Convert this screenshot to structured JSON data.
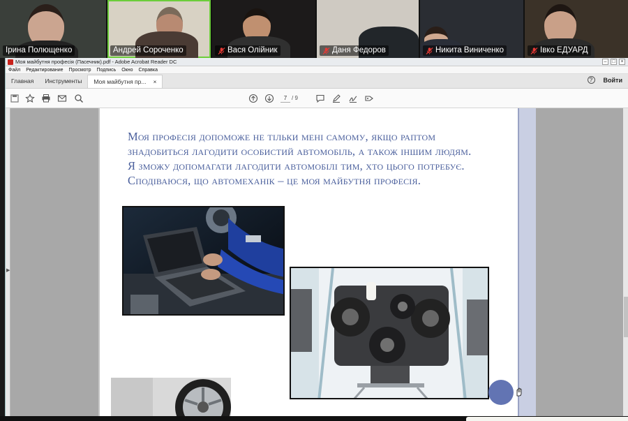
{
  "participants": [
    {
      "name": "Ірина Полющенко",
      "muted": false,
      "active": false,
      "bg": "#3a3f3a",
      "skin": "#cba590",
      "hair": "#2a1f1a",
      "shirt": "#222222"
    },
    {
      "name": "Андрей Сороченко",
      "muted": false,
      "active": true,
      "bg": "#d8d2c4",
      "skin": "#b88a72",
      "hair": "#7a6a5a",
      "shirt": "#4a3b34"
    },
    {
      "name": "Вася Олійник",
      "muted": true,
      "active": false,
      "bg": "#1c1a1a",
      "skin": "#c09070",
      "hair": "#1a1410",
      "shirt": "#303030"
    },
    {
      "name": "Даня Федоров",
      "muted": true,
      "active": false,
      "bg": "#cfcac2",
      "skin": "#b88f78",
      "hair": "#3d2e24",
      "shirt": "#22262a"
    },
    {
      "name": "Никита Виниченко",
      "muted": true,
      "active": false,
      "bg": "#2a2d33",
      "skin": "#d0a990",
      "hair": "#2a1e18",
      "shirt": "#2a2e38"
    },
    {
      "name": "Івко ЕДУАРД",
      "muted": true,
      "active": false,
      "bg": "#3b3228",
      "skin": "#c9a088",
      "hair": "#1e1612",
      "shirt": "#2b2b2b"
    }
  ],
  "window": {
    "title": "Моя майбутня професія (Пасечник).pdf - Adobe Acrobat Reader DC",
    "controls": [
      "–",
      "□",
      "×"
    ]
  },
  "menu": [
    "Файл",
    "Редактирование",
    "Просмотр",
    "Подпись",
    "Окно",
    "Справка"
  ],
  "tabs": {
    "home": "Главная",
    "tools": "Инструменты",
    "document": "Моя майбутня пр...",
    "close": "×",
    "help": "?",
    "signin": "Войти"
  },
  "toolbar": {
    "current_page": "7",
    "total_pages": "/ 9"
  },
  "document": {
    "paragraph": "Моя професія допоможе не тільки мені самому, якщо раптом знадобиться лагодити особистий автомобіль, а також іншим людям. Я зможу допомагати лагодити автомобілі тим, хто цього потребує. Сподіваюся, що автомеханік – це моя майбутня професія."
  },
  "colors": {
    "accent_text": "#4a5f9c",
    "active_speaker": "#6ccd3a",
    "muted_icon": "#e53935",
    "pointer_dot": "#6274b3"
  },
  "icons": [
    "save-icon",
    "bookmark-star-icon",
    "print-icon",
    "email-icon",
    "zoom-search-icon",
    "page-up-icon",
    "page-down-icon",
    "comment-icon",
    "highlight-pen-icon",
    "sign-icon",
    "share-icon"
  ]
}
